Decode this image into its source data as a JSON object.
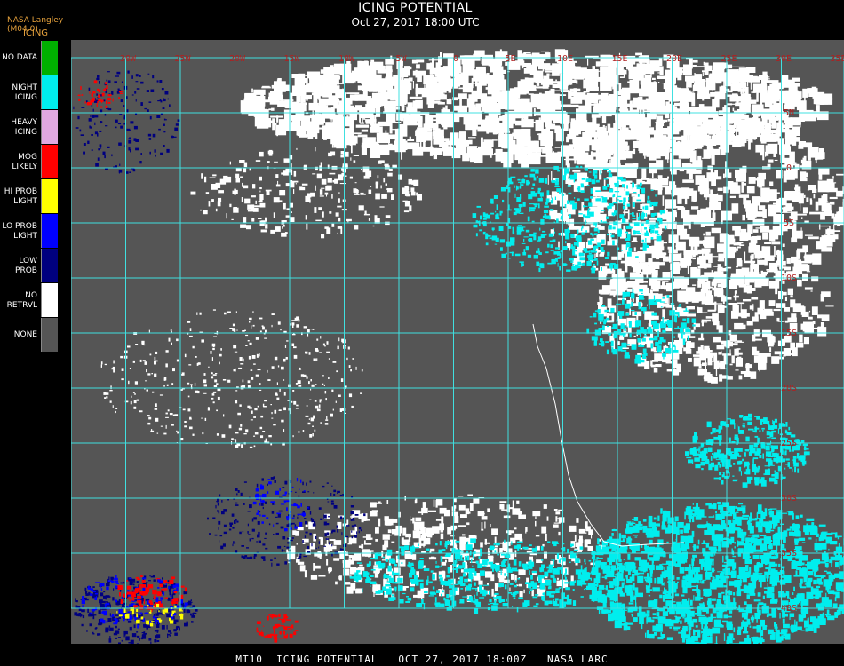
{
  "header": {
    "producer": "NASA Langley (M04.0)",
    "legend_title": "ICING",
    "title": "ICING POTENTIAL",
    "subtitle": "Oct 27, 2017 18:00 UTC"
  },
  "legend": [
    {
      "label": "NO DATA",
      "color": "#00b000"
    },
    {
      "label": "NIGHT\nICING",
      "color": "#00eeee"
    },
    {
      "label": "HEAVY\nICING",
      "color": "#e0a8e0"
    },
    {
      "label": "MOG\nLIKELY",
      "color": "#ff0000"
    },
    {
      "label": "HI PROB\nLIGHT",
      "color": "#ffff00"
    },
    {
      "label": "LO PROB\nLIGHT",
      "color": "#0000ff"
    },
    {
      "label": "LOW\nPROB",
      "color": "#00007f"
    },
    {
      "label": "NO\nRETRVL",
      "color": "#ffffff"
    },
    {
      "label": "NONE",
      "color": "#555555"
    }
  ],
  "map": {
    "background_color": "#555555",
    "grid_color": "#40e0e0",
    "label_color": "#b02020",
    "longitude_labels": [
      "30W",
      "25W",
      "20W",
      "15W",
      "10W",
      "5W",
      "0",
      "5E",
      "10E",
      "15E",
      "20E",
      "25E",
      "30E",
      "35E"
    ],
    "latitude_labels": [
      "5N",
      "0",
      "5S",
      "10S",
      "15S",
      "20S",
      "25S",
      "30S",
      "35S",
      "40S"
    ]
  },
  "footer": "MT10  ICING POTENTIAL   OCT 27, 2017 18:00Z   NASA LARC"
}
